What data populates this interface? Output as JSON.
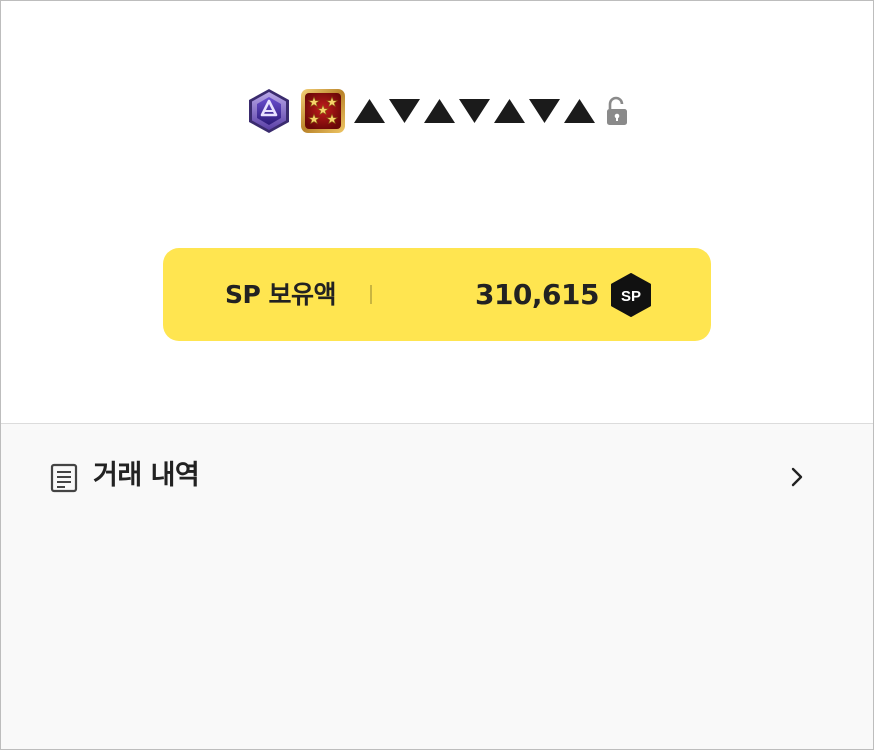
{
  "profile": {
    "rank_badge_icon": "rank-hexagon-badge",
    "level_badge_icon": "five-star-badge",
    "masked_name": "▲▼▲▼▲▼▲",
    "lock_icon": "unlocked-padlock-icon"
  },
  "sp_balance": {
    "label": "SP 보유액",
    "amount": "310,615",
    "coin_icon_text": "SP"
  },
  "menu": {
    "transaction_history_label": "거래 내역"
  },
  "colors": {
    "accent_yellow": "#ffe550",
    "text_dark": "#222222",
    "bottom_background": "#f9f9f9"
  }
}
